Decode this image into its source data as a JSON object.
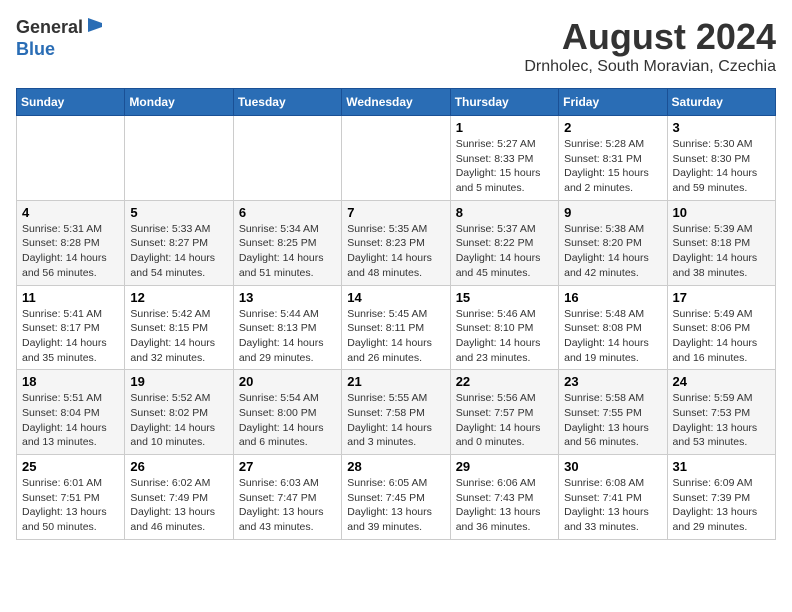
{
  "header": {
    "logo_general": "General",
    "logo_blue": "Blue",
    "title": "August 2024",
    "subtitle": "Drnholec, South Moravian, Czechia"
  },
  "weekdays": [
    "Sunday",
    "Monday",
    "Tuesday",
    "Wednesday",
    "Thursday",
    "Friday",
    "Saturday"
  ],
  "weeks": [
    [
      {
        "day": "",
        "info": ""
      },
      {
        "day": "",
        "info": ""
      },
      {
        "day": "",
        "info": ""
      },
      {
        "day": "",
        "info": ""
      },
      {
        "day": "1",
        "info": "Sunrise: 5:27 AM\nSunset: 8:33 PM\nDaylight: 15 hours\nand 5 minutes."
      },
      {
        "day": "2",
        "info": "Sunrise: 5:28 AM\nSunset: 8:31 PM\nDaylight: 15 hours\nand 2 minutes."
      },
      {
        "day": "3",
        "info": "Sunrise: 5:30 AM\nSunset: 8:30 PM\nDaylight: 14 hours\nand 59 minutes."
      }
    ],
    [
      {
        "day": "4",
        "info": "Sunrise: 5:31 AM\nSunset: 8:28 PM\nDaylight: 14 hours\nand 56 minutes."
      },
      {
        "day": "5",
        "info": "Sunrise: 5:33 AM\nSunset: 8:27 PM\nDaylight: 14 hours\nand 54 minutes."
      },
      {
        "day": "6",
        "info": "Sunrise: 5:34 AM\nSunset: 8:25 PM\nDaylight: 14 hours\nand 51 minutes."
      },
      {
        "day": "7",
        "info": "Sunrise: 5:35 AM\nSunset: 8:23 PM\nDaylight: 14 hours\nand 48 minutes."
      },
      {
        "day": "8",
        "info": "Sunrise: 5:37 AM\nSunset: 8:22 PM\nDaylight: 14 hours\nand 45 minutes."
      },
      {
        "day": "9",
        "info": "Sunrise: 5:38 AM\nSunset: 8:20 PM\nDaylight: 14 hours\nand 42 minutes."
      },
      {
        "day": "10",
        "info": "Sunrise: 5:39 AM\nSunset: 8:18 PM\nDaylight: 14 hours\nand 38 minutes."
      }
    ],
    [
      {
        "day": "11",
        "info": "Sunrise: 5:41 AM\nSunset: 8:17 PM\nDaylight: 14 hours\nand 35 minutes."
      },
      {
        "day": "12",
        "info": "Sunrise: 5:42 AM\nSunset: 8:15 PM\nDaylight: 14 hours\nand 32 minutes."
      },
      {
        "day": "13",
        "info": "Sunrise: 5:44 AM\nSunset: 8:13 PM\nDaylight: 14 hours\nand 29 minutes."
      },
      {
        "day": "14",
        "info": "Sunrise: 5:45 AM\nSunset: 8:11 PM\nDaylight: 14 hours\nand 26 minutes."
      },
      {
        "day": "15",
        "info": "Sunrise: 5:46 AM\nSunset: 8:10 PM\nDaylight: 14 hours\nand 23 minutes."
      },
      {
        "day": "16",
        "info": "Sunrise: 5:48 AM\nSunset: 8:08 PM\nDaylight: 14 hours\nand 19 minutes."
      },
      {
        "day": "17",
        "info": "Sunrise: 5:49 AM\nSunset: 8:06 PM\nDaylight: 14 hours\nand 16 minutes."
      }
    ],
    [
      {
        "day": "18",
        "info": "Sunrise: 5:51 AM\nSunset: 8:04 PM\nDaylight: 14 hours\nand 13 minutes."
      },
      {
        "day": "19",
        "info": "Sunrise: 5:52 AM\nSunset: 8:02 PM\nDaylight: 14 hours\nand 10 minutes."
      },
      {
        "day": "20",
        "info": "Sunrise: 5:54 AM\nSunset: 8:00 PM\nDaylight: 14 hours\nand 6 minutes."
      },
      {
        "day": "21",
        "info": "Sunrise: 5:55 AM\nSunset: 7:58 PM\nDaylight: 14 hours\nand 3 minutes."
      },
      {
        "day": "22",
        "info": "Sunrise: 5:56 AM\nSunset: 7:57 PM\nDaylight: 14 hours\nand 0 minutes."
      },
      {
        "day": "23",
        "info": "Sunrise: 5:58 AM\nSunset: 7:55 PM\nDaylight: 13 hours\nand 56 minutes."
      },
      {
        "day": "24",
        "info": "Sunrise: 5:59 AM\nSunset: 7:53 PM\nDaylight: 13 hours\nand 53 minutes."
      }
    ],
    [
      {
        "day": "25",
        "info": "Sunrise: 6:01 AM\nSunset: 7:51 PM\nDaylight: 13 hours\nand 50 minutes."
      },
      {
        "day": "26",
        "info": "Sunrise: 6:02 AM\nSunset: 7:49 PM\nDaylight: 13 hours\nand 46 minutes."
      },
      {
        "day": "27",
        "info": "Sunrise: 6:03 AM\nSunset: 7:47 PM\nDaylight: 13 hours\nand 43 minutes."
      },
      {
        "day": "28",
        "info": "Sunrise: 6:05 AM\nSunset: 7:45 PM\nDaylight: 13 hours\nand 39 minutes."
      },
      {
        "day": "29",
        "info": "Sunrise: 6:06 AM\nSunset: 7:43 PM\nDaylight: 13 hours\nand 36 minutes."
      },
      {
        "day": "30",
        "info": "Sunrise: 6:08 AM\nSunset: 7:41 PM\nDaylight: 13 hours\nand 33 minutes."
      },
      {
        "day": "31",
        "info": "Sunrise: 6:09 AM\nSunset: 7:39 PM\nDaylight: 13 hours\nand 29 minutes."
      }
    ]
  ]
}
